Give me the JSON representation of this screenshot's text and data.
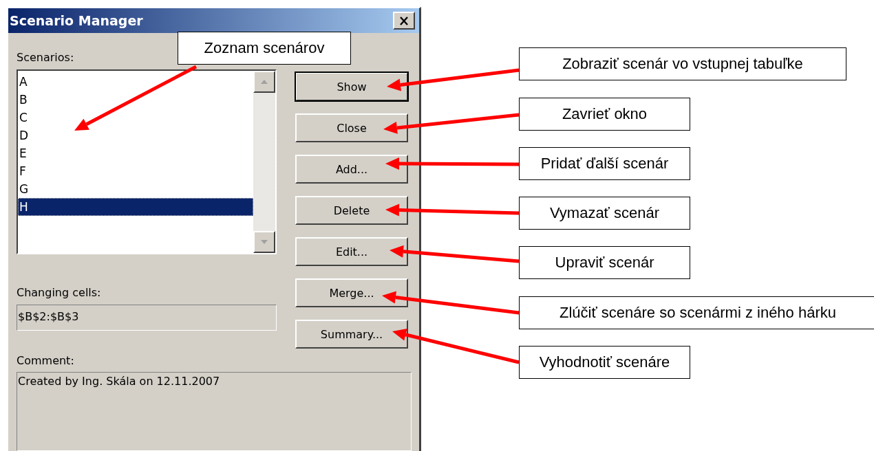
{
  "window": {
    "title": "Scenario Manager"
  },
  "scenarios": {
    "label": "Scenarios:",
    "items": [
      {
        "name": "A",
        "selected": false
      },
      {
        "name": "B",
        "selected": false
      },
      {
        "name": "C",
        "selected": false
      },
      {
        "name": "D",
        "selected": false
      },
      {
        "name": "E",
        "selected": false
      },
      {
        "name": "F",
        "selected": false
      },
      {
        "name": "G",
        "selected": false
      },
      {
        "name": "H",
        "selected": true
      }
    ]
  },
  "buttons": [
    {
      "label": "Show",
      "default": true
    },
    {
      "label": "Close",
      "default": false
    },
    {
      "label": "Add...",
      "default": false
    },
    {
      "label": "Delete",
      "default": false
    },
    {
      "label": "Edit...",
      "default": false
    },
    {
      "label": "Merge...",
      "default": false
    },
    {
      "label": "Summary...",
      "default": false
    }
  ],
  "changing_cells": {
    "label": "Changing cells:",
    "value": "$B$2:$B$3"
  },
  "comment": {
    "label": "Comment:",
    "value": "Created by Ing. Skála on 12.11.2007"
  },
  "annotations": [
    {
      "text": "Zoznam scenárov"
    },
    {
      "text": "Zobraziť scenár vo vstupnej tabuľke"
    },
    {
      "text": "Zavrieť okno"
    },
    {
      "text": "Pridať ďalší scenár"
    },
    {
      "text": "Vymazať scenár"
    },
    {
      "text": "Upraviť scenár"
    },
    {
      "text": "Zlúčiť scenáre so scenármi z iného hárku"
    },
    {
      "text": "Vyhodnotiť scenáre"
    }
  ]
}
